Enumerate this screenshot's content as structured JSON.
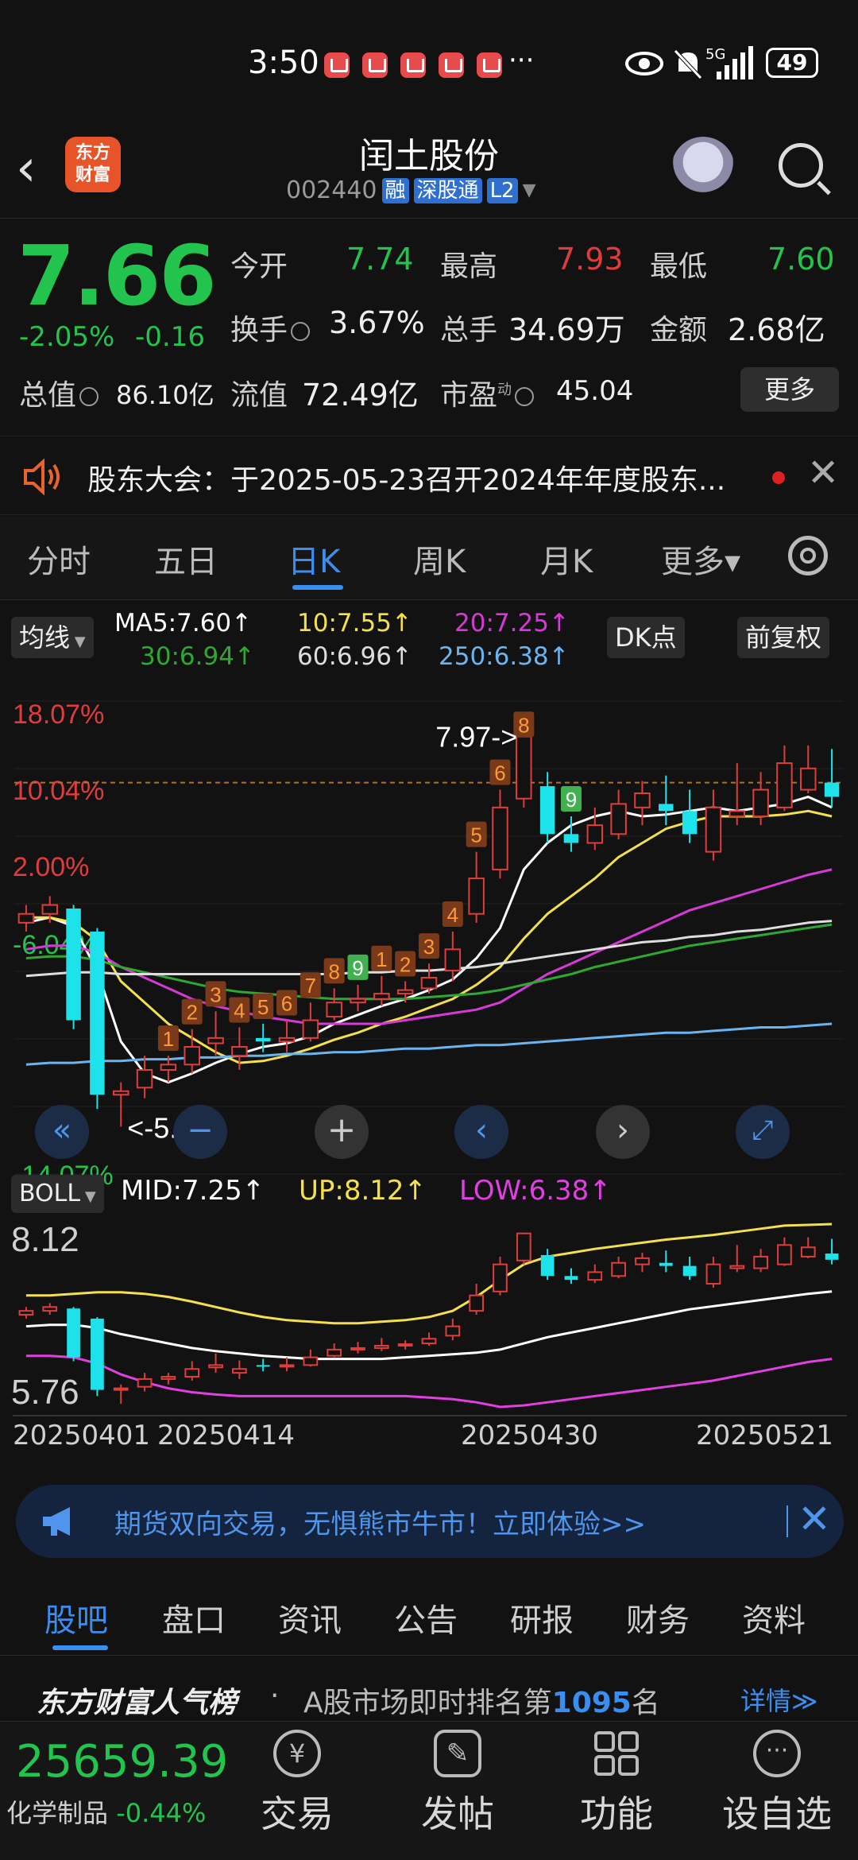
{
  "status": {
    "time": "3:50",
    "more": "···",
    "battery": "49",
    "network": "5G"
  },
  "header": {
    "back": "‹",
    "logo": "东方\n财富",
    "logo_line1": "东方",
    "logo_line2": "财富",
    "title": "闰土股份",
    "code": "002440",
    "tag_rong": "融",
    "tag_sgt": "深股通",
    "tag_l2": "L2"
  },
  "quote": {
    "price": "7.66",
    "change_pct": "-2.05%",
    "change": "-0.16",
    "open_label": "今开",
    "open": "7.74",
    "high_label": "最高",
    "high": "7.93",
    "low_label": "最低",
    "low": "7.60",
    "turnover_label": "换手",
    "turnover": "3.67%",
    "volume_label": "总手",
    "volume": "34.69万",
    "amount_label": "金额",
    "amount": "2.68亿",
    "mktcap_label": "总值",
    "mktcap": "86.10亿",
    "float_label": "流值",
    "float": "72.49亿",
    "pe_label": "市盈",
    "pe_sup": "动",
    "pe": "45.04",
    "more": "更多"
  },
  "notice": {
    "text": "股东大会：于2025-05-23召开2024年年度股东..."
  },
  "ktabs": [
    "分时",
    "五日",
    "日K",
    "周K",
    "月K",
    "更多▾"
  ],
  "ma_legend": {
    "type": "均线",
    "ma5": "MA5:7.60↑",
    "ma10": "10:7.55↑",
    "ma20": "20:7.25↑",
    "ma30": "30:6.94↑",
    "ma60": "60:6.96↑",
    "ma250": "250:6.38↑",
    "dk": "DK点",
    "adj": "前复权"
  },
  "main_chart": {
    "pct_labels": [
      "18.07%",
      "10.04%",
      "2.00%",
      "-6.04%",
      "-14.07%"
    ],
    "high_label": "7.97->",
    "low_label": "<-5.80"
  },
  "boll": {
    "type": "BOLL",
    "mid": "MID:7.25↑",
    "up": "UP:8.12↑",
    "low": "LOW:6.38↑",
    "top": "8.12",
    "bottom": "5.76"
  },
  "dates": [
    "20250401",
    "20250414",
    "20250430",
    "20250521"
  ],
  "chart_data": {
    "type": "candlestick",
    "x": [
      "20250401",
      "20250402",
      "20250403",
      "20250407",
      "20250408",
      "20250409",
      "20250410",
      "20250411",
      "20250414",
      "20250415",
      "20250416",
      "20250417",
      "20250418",
      "20250421",
      "20250422",
      "20250423",
      "20250424",
      "20250425",
      "20250428",
      "20250429",
      "20250430",
      "20250506",
      "20250507",
      "20250508",
      "20250509",
      "20250512",
      "20250513",
      "20250514",
      "20250515",
      "20250516",
      "20250519",
      "20250520",
      "20250521",
      "20250522",
      "20250523"
    ],
    "open": [
      6.95,
      7.0,
      7.03,
      6.9,
      5.98,
      6.02,
      6.12,
      6.15,
      6.27,
      6.2,
      6.3,
      6.28,
      6.3,
      6.42,
      6.5,
      6.52,
      6.55,
      6.58,
      6.68,
      7.0,
      7.25,
      7.65,
      7.72,
      7.45,
      7.4,
      7.45,
      7.6,
      7.62,
      7.58,
      7.35,
      7.55,
      7.55,
      7.6,
      7.7,
      7.74
    ],
    "close": [
      7.0,
      7.05,
      6.4,
      5.98,
      6.0,
      6.12,
      6.15,
      6.25,
      6.3,
      6.25,
      6.28,
      6.3,
      6.4,
      6.5,
      6.52,
      6.55,
      6.57,
      6.64,
      6.8,
      7.2,
      7.6,
      8.0,
      7.45,
      7.4,
      7.5,
      7.62,
      7.68,
      7.58,
      7.45,
      7.6,
      7.58,
      7.7,
      7.85,
      7.82,
      7.66
    ],
    "high": [
      7.05,
      7.1,
      7.05,
      6.92,
      6.05,
      6.2,
      6.2,
      6.35,
      6.45,
      6.36,
      6.38,
      6.4,
      6.5,
      6.58,
      6.6,
      6.65,
      6.62,
      6.72,
      6.9,
      7.35,
      7.7,
      7.97,
      7.8,
      7.55,
      7.6,
      7.7,
      7.75,
      7.78,
      7.7,
      7.7,
      7.85,
      7.8,
      7.95,
      7.95,
      7.93
    ],
    "low": [
      6.9,
      6.95,
      6.35,
      5.9,
      5.8,
      5.96,
      6.05,
      6.1,
      6.2,
      6.12,
      6.22,
      6.22,
      6.28,
      6.4,
      6.45,
      6.48,
      6.5,
      6.55,
      6.62,
      6.95,
      7.2,
      7.6,
      7.4,
      7.35,
      7.36,
      7.42,
      7.5,
      7.5,
      7.4,
      7.3,
      7.5,
      7.5,
      7.58,
      7.68,
      7.6
    ],
    "ylim": [
      5.6,
      8.2
    ],
    "series": [
      {
        "name": "MA5",
        "values": [
          6.95,
          6.98,
          6.93,
          6.68,
          6.28,
          6.1,
          6.05,
          6.1,
          6.16,
          6.21,
          6.25,
          6.27,
          6.31,
          6.38,
          6.43,
          6.48,
          6.52,
          6.57,
          6.63,
          6.75,
          6.92,
          7.25,
          7.4,
          7.5,
          7.55,
          7.58,
          7.55,
          7.56,
          7.58,
          7.6,
          7.58,
          7.6,
          7.62,
          7.66,
          7.6
        ]
      },
      {
        "name": "10",
        "values": [
          6.98,
          6.98,
          6.95,
          6.85,
          6.62,
          6.5,
          6.38,
          6.3,
          6.22,
          6.16,
          6.17,
          6.2,
          6.24,
          6.29,
          6.33,
          6.38,
          6.42,
          6.47,
          6.52,
          6.6,
          6.7,
          6.86,
          7.0,
          7.1,
          7.2,
          7.32,
          7.4,
          7.48,
          7.52,
          7.55,
          7.55,
          7.55,
          7.56,
          7.58,
          7.55
        ]
      },
      {
        "name": "20",
        "values": [
          6.8,
          6.82,
          6.82,
          6.78,
          6.7,
          6.64,
          6.58,
          6.52,
          6.48,
          6.45,
          6.42,
          6.4,
          6.38,
          6.38,
          6.38,
          6.38,
          6.4,
          6.42,
          6.44,
          6.46,
          6.5,
          6.58,
          6.66,
          6.72,
          6.78,
          6.84,
          6.9,
          6.96,
          7.02,
          7.06,
          7.1,
          7.14,
          7.18,
          7.22,
          7.25
        ]
      },
      {
        "name": "30",
        "values": [
          6.75,
          6.76,
          6.76,
          6.74,
          6.7,
          6.67,
          6.64,
          6.61,
          6.58,
          6.56,
          6.55,
          6.54,
          6.53,
          6.52,
          6.52,
          6.52,
          6.52,
          6.53,
          6.54,
          6.55,
          6.57,
          6.6,
          6.63,
          6.66,
          6.7,
          6.73,
          6.76,
          6.79,
          6.82,
          6.84,
          6.86,
          6.88,
          6.9,
          6.92,
          6.94
        ]
      },
      {
        "name": "60",
        "values": [
          6.65,
          6.66,
          6.67,
          6.67,
          6.66,
          6.66,
          6.66,
          6.66,
          6.66,
          6.66,
          6.66,
          6.66,
          6.66,
          6.66,
          6.67,
          6.67,
          6.68,
          6.68,
          6.69,
          6.7,
          6.72,
          6.74,
          6.76,
          6.78,
          6.8,
          6.82,
          6.84,
          6.85,
          6.87,
          6.88,
          6.9,
          6.91,
          6.93,
          6.95,
          6.96
        ]
      },
      {
        "name": "250",
        "values": [
          6.15,
          6.16,
          6.16,
          6.17,
          6.17,
          6.18,
          6.18,
          6.19,
          6.19,
          6.2,
          6.2,
          6.21,
          6.21,
          6.22,
          6.22,
          6.23,
          6.24,
          6.24,
          6.25,
          6.26,
          6.26,
          6.27,
          6.28,
          6.29,
          6.3,
          6.31,
          6.32,
          6.33,
          6.33,
          6.34,
          6.35,
          6.36,
          6.36,
          6.37,
          6.38
        ]
      }
    ],
    "td_counts": [
      null,
      null,
      null,
      null,
      null,
      null,
      "1",
      "2",
      "3",
      "4",
      "5",
      "6",
      "7",
      "8",
      "9",
      "1",
      "2",
      "3",
      "4",
      "5",
      "6",
      "8",
      null,
      "9",
      null,
      null,
      null,
      null,
      null,
      null,
      null,
      null,
      null,
      null,
      null
    ],
    "boll_ylim": [
      5.76,
      8.12
    ],
    "boll_series": [
      {
        "name": "UP",
        "values": [
          7.2,
          7.2,
          7.22,
          7.24,
          7.24,
          7.22,
          7.18,
          7.12,
          7.05,
          6.98,
          6.92,
          6.88,
          6.86,
          6.84,
          6.84,
          6.86,
          6.88,
          6.92,
          7.0,
          7.18,
          7.4,
          7.6,
          7.7,
          7.75,
          7.8,
          7.84,
          7.88,
          7.92,
          7.95,
          7.98,
          8.02,
          8.06,
          8.1,
          8.11,
          8.12
        ]
      },
      {
        "name": "MID",
        "values": [
          6.8,
          6.82,
          6.82,
          6.78,
          6.7,
          6.64,
          6.58,
          6.52,
          6.48,
          6.45,
          6.42,
          6.4,
          6.38,
          6.38,
          6.38,
          6.38,
          6.4,
          6.42,
          6.44,
          6.46,
          6.5,
          6.58,
          6.66,
          6.72,
          6.78,
          6.84,
          6.9,
          6.96,
          7.02,
          7.06,
          7.1,
          7.14,
          7.18,
          7.22,
          7.25
        ]
      },
      {
        "name": "LOW",
        "values": [
          6.42,
          6.42,
          6.4,
          6.32,
          6.18,
          6.08,
          6.0,
          5.95,
          5.92,
          5.9,
          5.9,
          5.9,
          5.9,
          5.9,
          5.9,
          5.9,
          5.9,
          5.88,
          5.86,
          5.82,
          5.76,
          5.78,
          5.82,
          5.86,
          5.9,
          5.94,
          5.98,
          6.02,
          6.06,
          6.1,
          6.16,
          6.22,
          6.28,
          6.34,
          6.38
        ]
      }
    ]
  },
  "banner": {
    "text": "期货双向交易，无惧熊市牛市！立即体验>>"
  },
  "btabs": [
    "股吧",
    "盘口",
    "资讯",
    "公告",
    "研报",
    "财务",
    "资料"
  ],
  "rank": {
    "brand": "东方财富人气榜",
    "dot": "·",
    "text": "A股市场即时排名第",
    "num": "1095",
    "suffix": "名",
    "more": "详情≫"
  },
  "bottom": {
    "index_value": "25659.39",
    "index_name": "化学制品",
    "index_change": "-0.44%",
    "nav": [
      "交易",
      "发帖",
      "功能",
      "设自选"
    ]
  },
  "colors": {
    "up": "#e03c3c",
    "down": "#22c44d",
    "accent": "#3a8ef0",
    "cyan": "#1de2ea"
  }
}
